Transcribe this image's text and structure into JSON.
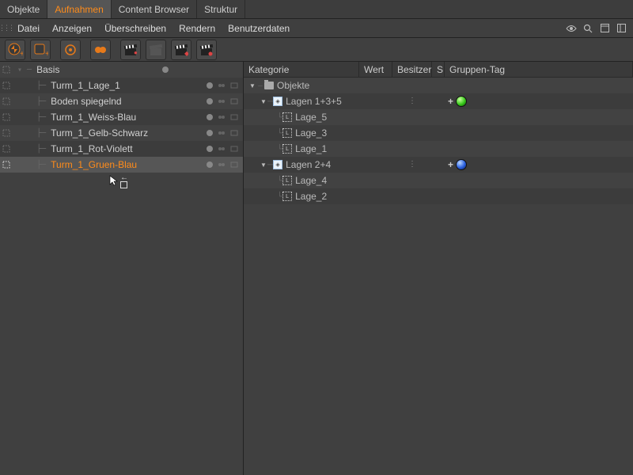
{
  "tabs": {
    "objekte": "Objekte",
    "aufnahmen": "Aufnahmen",
    "content": "Content Browser",
    "struktur": "Struktur"
  },
  "menu": {
    "datei": "Datei",
    "anzeigen": "Anzeigen",
    "ueberschreiben": "Überschreiben",
    "rendern": "Rendern",
    "benutzerdaten": "Benutzerdaten"
  },
  "left": {
    "items": [
      {
        "label": "Basis",
        "depth": 0,
        "sel": false
      },
      {
        "label": "Turm_1_Lage_1",
        "depth": 1
      },
      {
        "label": "Boden spiegelnd",
        "depth": 1
      },
      {
        "label": "Turm_1_Weiss-Blau",
        "depth": 1
      },
      {
        "label": "Turm_1_Gelb-Schwarz",
        "depth": 1
      },
      {
        "label": "Turm_1_Rot-Violett",
        "depth": 1
      },
      {
        "label": "Turm_1_Gruen-Blau",
        "depth": 1,
        "sel": true
      }
    ]
  },
  "rheaders": {
    "kategorie": "Kategorie",
    "wert": "Wert",
    "besitzer": "Besitzer",
    "s": "S",
    "tag": "Gruppen-Tag"
  },
  "right": {
    "rows": [
      {
        "type": "root",
        "label": "Objekte"
      },
      {
        "type": "group",
        "label": "Lagen 1+3+5",
        "sphere": "green"
      },
      {
        "type": "layer",
        "label": "Lage_5"
      },
      {
        "type": "layer",
        "label": "Lage_3"
      },
      {
        "type": "layer",
        "label": "Lage_1"
      },
      {
        "type": "group",
        "label": "Lagen 2+4",
        "sphere": "blue"
      },
      {
        "type": "layer",
        "label": "Lage_4"
      },
      {
        "type": "layer",
        "label": "Lage_2"
      }
    ]
  }
}
